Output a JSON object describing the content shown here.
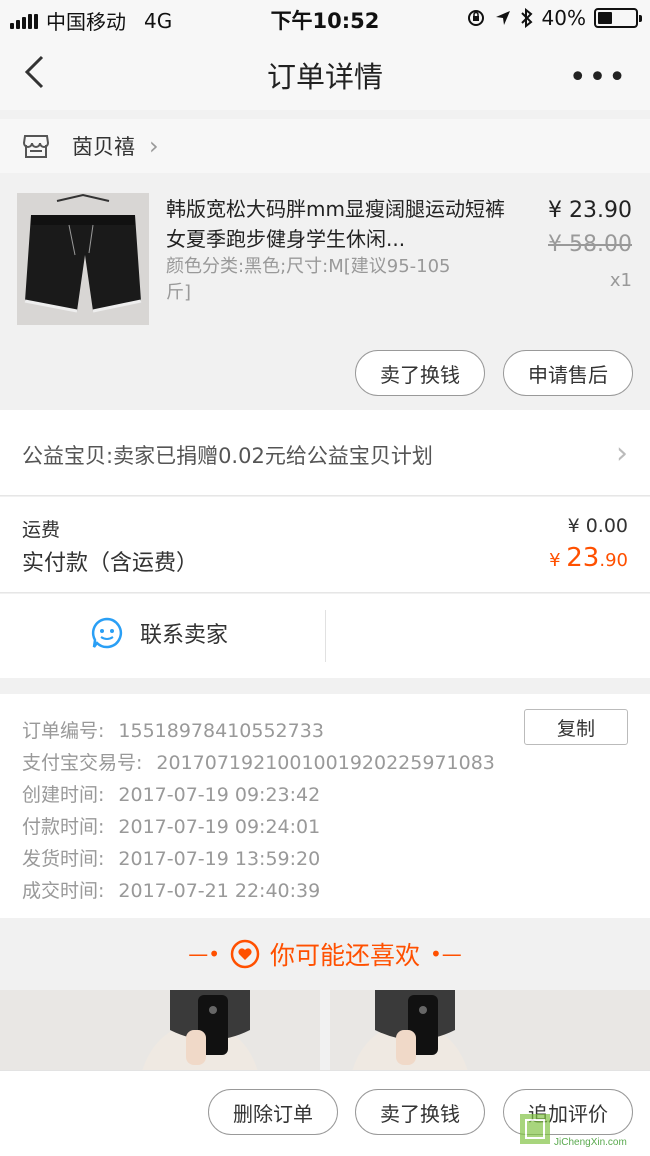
{
  "status_bar": {
    "carrier": "中国移动",
    "network": "4G",
    "time": "下午10:52",
    "battery": "40%",
    "battery_level": 0.4
  },
  "nav": {
    "title": "订单详情"
  },
  "shop": {
    "name": "茵贝禧"
  },
  "product": {
    "title": "韩版宽松大码胖mm显瘦阔腿运动短裤女夏季跑步健身学生休闲...",
    "spec": "颜色分类:黑色;尺寸:M[建议95-105斤]",
    "price": "¥ 23.90",
    "original_price": "¥ 58.00",
    "quantity": "x1",
    "sell_button": "卖了换钱",
    "aftersale_button": "申请售后"
  },
  "charity": {
    "text": "公益宝贝:卖家已捐赠0.02元给公益宝贝计划"
  },
  "fees": {
    "shipping_label": "运费",
    "shipping_value": "¥ 0.00",
    "total_label": "实付款（含运费）",
    "total_currency": "¥ ",
    "total_int": "23",
    "total_dec": ".90"
  },
  "contact": {
    "label": "联系卖家"
  },
  "order_info": {
    "copy_button": "复制",
    "rows": [
      {
        "label": "订单编号:",
        "value": "15518978410552733"
      },
      {
        "label": "支付宝交易号:",
        "value": "2017071921001001920225971083"
      },
      {
        "label": "创建时间:",
        "value": "2017-07-19 09:23:42"
      },
      {
        "label": "付款时间:",
        "value": "2017-07-19 09:24:01"
      },
      {
        "label": "发货时间:",
        "value": "2017-07-19 13:59:20"
      },
      {
        "label": "成交时间:",
        "value": "2017-07-21 22:40:39"
      }
    ]
  },
  "recommend": {
    "title": "你可能还喜欢"
  },
  "bottom_actions": {
    "delete": "删除订单",
    "sell": "卖了换钱",
    "review": "追加评价"
  },
  "watermark": {
    "text": "JiChengXin.com"
  },
  "colors": {
    "accent": "#ff5000",
    "blue": "#2a9ff5"
  }
}
